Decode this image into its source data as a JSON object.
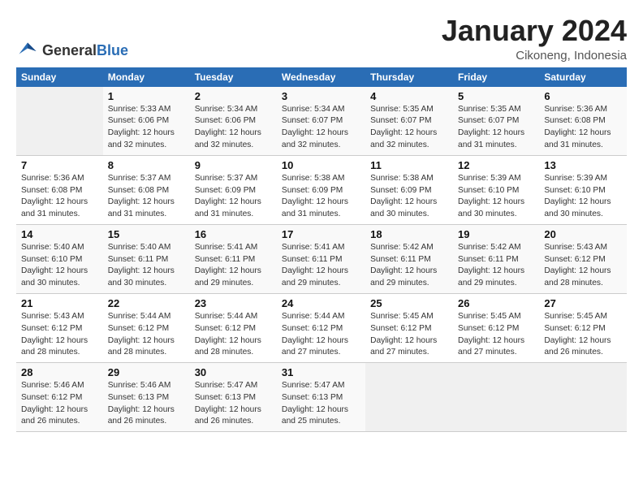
{
  "header": {
    "logo_general": "General",
    "logo_blue": "Blue",
    "month_title": "January 2024",
    "subtitle": "Cikoneng, Indonesia"
  },
  "days_of_week": [
    "Sunday",
    "Monday",
    "Tuesday",
    "Wednesday",
    "Thursday",
    "Friday",
    "Saturday"
  ],
  "weeks": [
    [
      {
        "day": "",
        "empty": true
      },
      {
        "day": "1",
        "sunrise": "5:33 AM",
        "sunset": "6:06 PM",
        "daylight": "12 hours and 32 minutes."
      },
      {
        "day": "2",
        "sunrise": "5:34 AM",
        "sunset": "6:06 PM",
        "daylight": "12 hours and 32 minutes."
      },
      {
        "day": "3",
        "sunrise": "5:34 AM",
        "sunset": "6:07 PM",
        "daylight": "12 hours and 32 minutes."
      },
      {
        "day": "4",
        "sunrise": "5:35 AM",
        "sunset": "6:07 PM",
        "daylight": "12 hours and 32 minutes."
      },
      {
        "day": "5",
        "sunrise": "5:35 AM",
        "sunset": "6:07 PM",
        "daylight": "12 hours and 31 minutes."
      },
      {
        "day": "6",
        "sunrise": "5:36 AM",
        "sunset": "6:08 PM",
        "daylight": "12 hours and 31 minutes."
      }
    ],
    [
      {
        "day": "7",
        "sunrise": "5:36 AM",
        "sunset": "6:08 PM",
        "daylight": "12 hours and 31 minutes."
      },
      {
        "day": "8",
        "sunrise": "5:37 AM",
        "sunset": "6:08 PM",
        "daylight": "12 hours and 31 minutes."
      },
      {
        "day": "9",
        "sunrise": "5:37 AM",
        "sunset": "6:09 PM",
        "daylight": "12 hours and 31 minutes."
      },
      {
        "day": "10",
        "sunrise": "5:38 AM",
        "sunset": "6:09 PM",
        "daylight": "12 hours and 31 minutes."
      },
      {
        "day": "11",
        "sunrise": "5:38 AM",
        "sunset": "6:09 PM",
        "daylight": "12 hours and 30 minutes."
      },
      {
        "day": "12",
        "sunrise": "5:39 AM",
        "sunset": "6:10 PM",
        "daylight": "12 hours and 30 minutes."
      },
      {
        "day": "13",
        "sunrise": "5:39 AM",
        "sunset": "6:10 PM",
        "daylight": "12 hours and 30 minutes."
      }
    ],
    [
      {
        "day": "14",
        "sunrise": "5:40 AM",
        "sunset": "6:10 PM",
        "daylight": "12 hours and 30 minutes."
      },
      {
        "day": "15",
        "sunrise": "5:40 AM",
        "sunset": "6:11 PM",
        "daylight": "12 hours and 30 minutes."
      },
      {
        "day": "16",
        "sunrise": "5:41 AM",
        "sunset": "6:11 PM",
        "daylight": "12 hours and 29 minutes."
      },
      {
        "day": "17",
        "sunrise": "5:41 AM",
        "sunset": "6:11 PM",
        "daylight": "12 hours and 29 minutes."
      },
      {
        "day": "18",
        "sunrise": "5:42 AM",
        "sunset": "6:11 PM",
        "daylight": "12 hours and 29 minutes."
      },
      {
        "day": "19",
        "sunrise": "5:42 AM",
        "sunset": "6:11 PM",
        "daylight": "12 hours and 29 minutes."
      },
      {
        "day": "20",
        "sunrise": "5:43 AM",
        "sunset": "6:12 PM",
        "daylight": "12 hours and 28 minutes."
      }
    ],
    [
      {
        "day": "21",
        "sunrise": "5:43 AM",
        "sunset": "6:12 PM",
        "daylight": "12 hours and 28 minutes."
      },
      {
        "day": "22",
        "sunrise": "5:44 AM",
        "sunset": "6:12 PM",
        "daylight": "12 hours and 28 minutes."
      },
      {
        "day": "23",
        "sunrise": "5:44 AM",
        "sunset": "6:12 PM",
        "daylight": "12 hours and 28 minutes."
      },
      {
        "day": "24",
        "sunrise": "5:44 AM",
        "sunset": "6:12 PM",
        "daylight": "12 hours and 27 minutes."
      },
      {
        "day": "25",
        "sunrise": "5:45 AM",
        "sunset": "6:12 PM",
        "daylight": "12 hours and 27 minutes."
      },
      {
        "day": "26",
        "sunrise": "5:45 AM",
        "sunset": "6:12 PM",
        "daylight": "12 hours and 27 minutes."
      },
      {
        "day": "27",
        "sunrise": "5:45 AM",
        "sunset": "6:12 PM",
        "daylight": "12 hours and 26 minutes."
      }
    ],
    [
      {
        "day": "28",
        "sunrise": "5:46 AM",
        "sunset": "6:12 PM",
        "daylight": "12 hours and 26 minutes."
      },
      {
        "day": "29",
        "sunrise": "5:46 AM",
        "sunset": "6:13 PM",
        "daylight": "12 hours and 26 minutes."
      },
      {
        "day": "30",
        "sunrise": "5:47 AM",
        "sunset": "6:13 PM",
        "daylight": "12 hours and 26 minutes."
      },
      {
        "day": "31",
        "sunrise": "5:47 AM",
        "sunset": "6:13 PM",
        "daylight": "12 hours and 25 minutes."
      },
      {
        "day": "",
        "empty": true
      },
      {
        "day": "",
        "empty": true
      },
      {
        "day": "",
        "empty": true
      }
    ]
  ],
  "labels": {
    "sunrise_prefix": "Sunrise: ",
    "sunset_prefix": "Sunset: ",
    "daylight_prefix": "Daylight: "
  }
}
